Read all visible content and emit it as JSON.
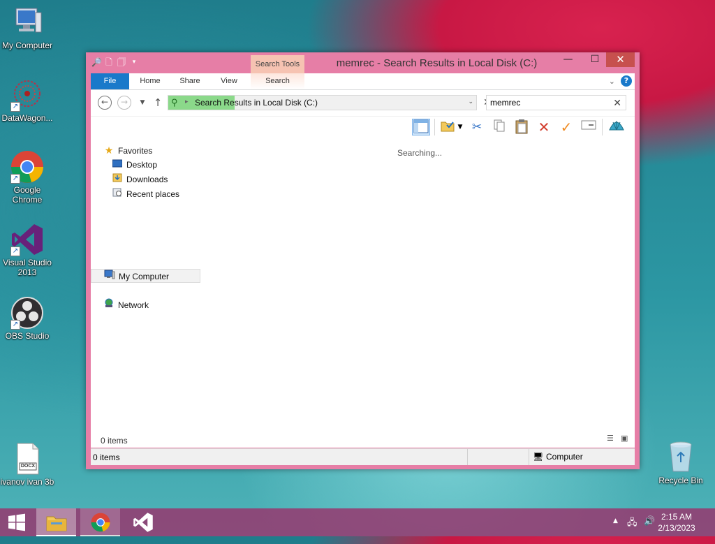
{
  "desktop": {
    "icons": [
      {
        "label": "My Computer"
      },
      {
        "label": "DataWagon..."
      },
      {
        "label": "Google Chrome"
      },
      {
        "label": "Visual Studio 2013"
      },
      {
        "label": "OBS Studio"
      },
      {
        "label": "ivanov ivan 3b"
      },
      {
        "label": "Recycle Bin"
      }
    ],
    "docx_badge": "DOCX"
  },
  "window": {
    "title": "memrec - Search Results in Local Disk (C:)",
    "context_tab_header": "Search Tools",
    "tabs": [
      "File",
      "Home",
      "Share",
      "View",
      "Search"
    ],
    "address_path": "Search Results in Local Disk (C:)",
    "search_value": "memrec",
    "nav_pane": {
      "favorites": "Favorites",
      "favorites_items": [
        "Desktop",
        "Downloads",
        "Recent places"
      ],
      "my_computer": "My Computer",
      "network": "Network"
    },
    "searching_text": "Searching...",
    "items_count": "0 items",
    "status": {
      "count": "0 items",
      "zone": "Computer"
    },
    "accent_color": "#e67ea6",
    "file_tab_color": "#1979ca"
  },
  "taskbar": {
    "time": "2:15 AM",
    "date": "2/13/2023"
  }
}
